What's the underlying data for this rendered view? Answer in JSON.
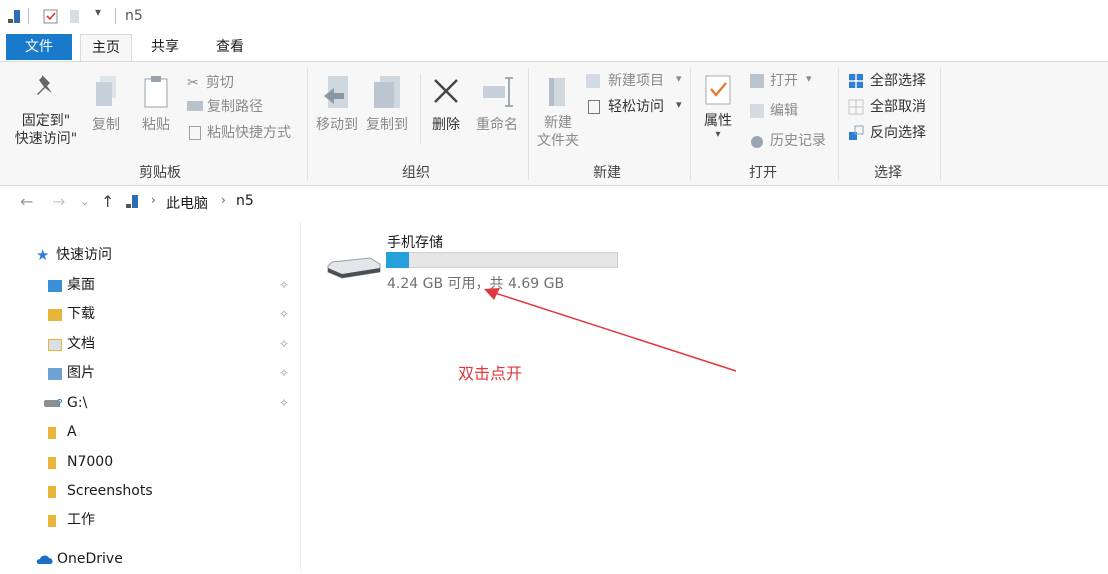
{
  "window": {
    "title": "n5"
  },
  "tabs": {
    "file": "文件",
    "home": "主页",
    "share": "共享",
    "view": "查看"
  },
  "ribbon": {
    "clipboard": {
      "pin_line1": "固定到\"",
      "pin_line2": "快速访问\"",
      "copy": "复制",
      "paste": "粘贴",
      "cut": "剪切",
      "copy_path": "复制路径",
      "paste_shortcut": "粘贴快捷方式",
      "group": "剪贴板"
    },
    "organize": {
      "move_to": "移动到",
      "copy_to": "复制到",
      "delete": "删除",
      "rename": "重命名",
      "group": "组织"
    },
    "new": {
      "new_folder_line1": "新建",
      "new_folder_line2": "文件夹",
      "new_item": "新建项目",
      "easy_access": "轻松访问",
      "group": "新建"
    },
    "open": {
      "properties": "属性",
      "open": "打开",
      "edit": "编辑",
      "history": "历史记录",
      "group": "打开"
    },
    "select": {
      "select_all": "全部选择",
      "select_none": "全部取消",
      "invert": "反向选择",
      "group": "选择"
    }
  },
  "address": {
    "pc": "此电脑",
    "folder": "n5"
  },
  "nav": {
    "quick_access": "快速访问",
    "items": [
      {
        "label": "桌面",
        "pinned": true
      },
      {
        "label": "下载",
        "pinned": true
      },
      {
        "label": "文档",
        "pinned": true
      },
      {
        "label": "图片",
        "pinned": true
      },
      {
        "label": "G:\\",
        "pinned": true
      },
      {
        "label": "A",
        "pinned": false
      },
      {
        "label": "N7000",
        "pinned": false
      },
      {
        "label": "Screenshots",
        "pinned": false
      },
      {
        "label": "工作",
        "pinned": false
      }
    ],
    "onedrive": "OneDrive"
  },
  "drive": {
    "name": "手机存储",
    "space": "4.24 GB 可用，共 4.69 GB",
    "used_fraction": 0.1
  },
  "annotation": {
    "text": "双击点开",
    "color": "#e0383e"
  },
  "colors": {
    "accent": "#1979ca",
    "drive_fill": "#26a0da"
  }
}
